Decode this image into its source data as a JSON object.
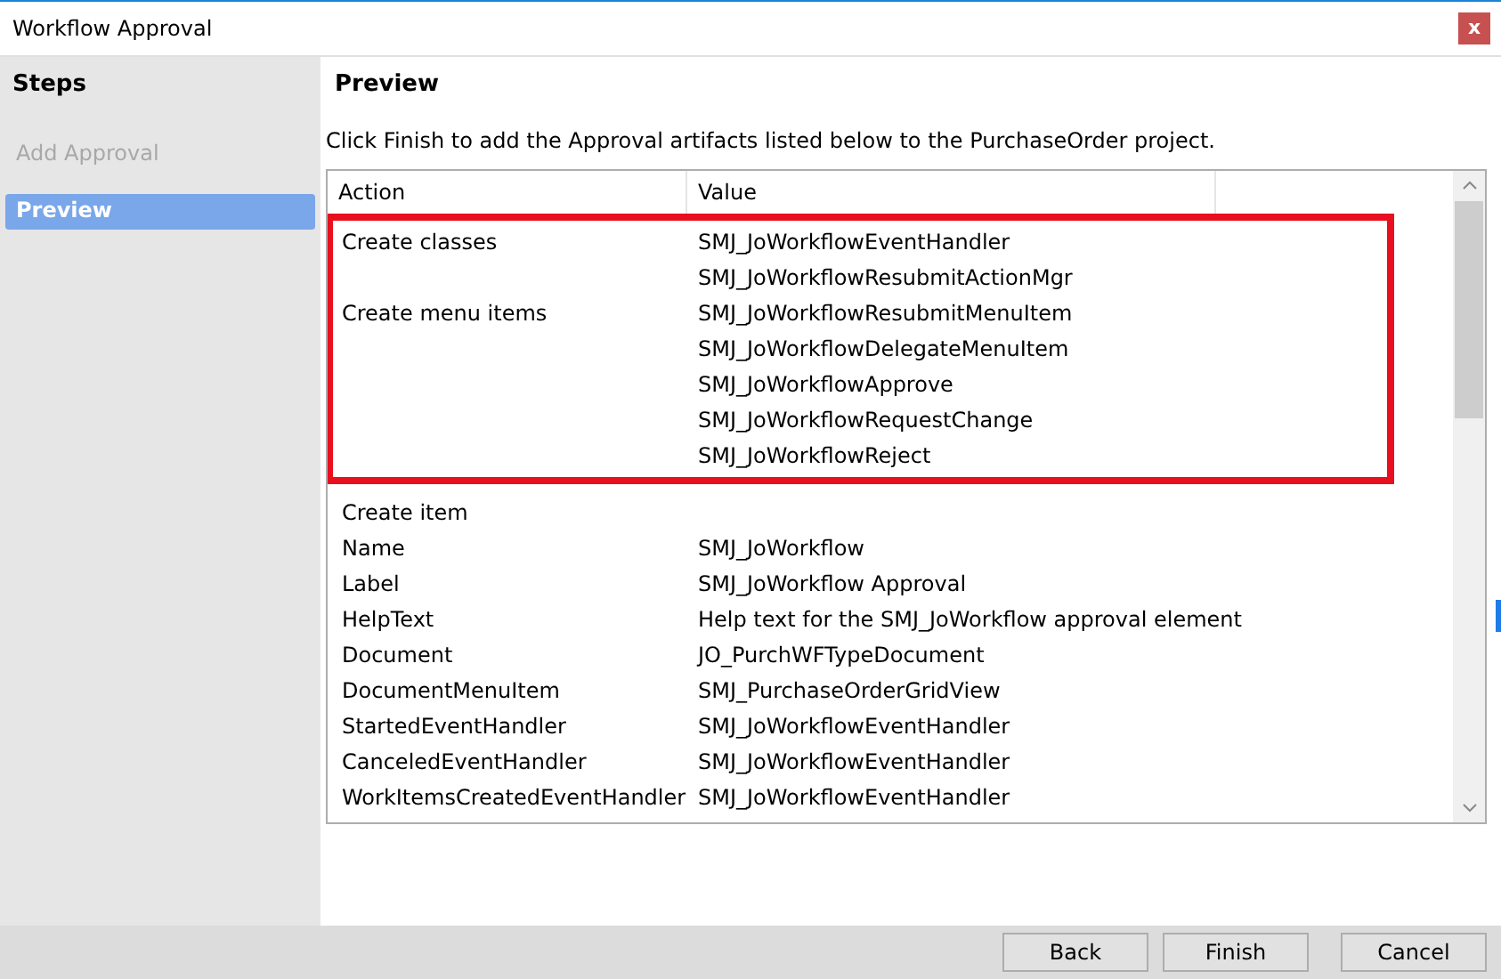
{
  "window": {
    "title": "Workflow Approval",
    "close_label": "x"
  },
  "sidebar": {
    "title": "Steps",
    "items": [
      {
        "label": "Add Approval",
        "selected": false,
        "disabled": true
      },
      {
        "label": "Preview",
        "selected": true,
        "disabled": false
      }
    ]
  },
  "main": {
    "title": "Preview",
    "instruction": "Click Finish to add the Approval artifacts listed below to the PurchaseOrder project."
  },
  "table": {
    "columns": [
      "Action",
      "Value"
    ],
    "groups": [
      {
        "highlighted": true,
        "rows": [
          {
            "action": "Create classes",
            "value": "SMJ_JoWorkflowEventHandler"
          },
          {
            "action": "",
            "value": "SMJ_JoWorkflowResubmitActionMgr"
          },
          {
            "action": "Create menu items",
            "value": "SMJ_JoWorkflowResubmitMenuItem"
          },
          {
            "action": "",
            "value": "SMJ_JoWorkflowDelegateMenuItem"
          },
          {
            "action": "",
            "value": "SMJ_JoWorkflowApprove"
          },
          {
            "action": "",
            "value": "SMJ_JoWorkflowRequestChange"
          },
          {
            "action": "",
            "value": "SMJ_JoWorkflowReject"
          }
        ]
      },
      {
        "highlighted": false,
        "rows": [
          {
            "action": "Create item",
            "value": ""
          },
          {
            "action": "Name",
            "value": "SMJ_JoWorkflow"
          },
          {
            "action": "Label",
            "value": "SMJ_JoWorkflow Approval"
          },
          {
            "action": "HelpText",
            "value": "Help text for the SMJ_JoWorkflow approval element"
          },
          {
            "action": "Document",
            "value": "JO_PurchWFTypeDocument"
          },
          {
            "action": "DocumentMenuItem",
            "value": "SMJ_PurchaseOrderGridView"
          },
          {
            "action": "StartedEventHandler",
            "value": "SMJ_JoWorkflowEventHandler"
          },
          {
            "action": "CanceledEventHandler",
            "value": "SMJ_JoWorkflowEventHandler"
          },
          {
            "action": "WorkItemsCreatedEventHandler",
            "value": "SMJ_JoWorkflowEventHandler"
          }
        ]
      }
    ]
  },
  "buttons": [
    "Back",
    "Finish",
    "Cancel"
  ]
}
